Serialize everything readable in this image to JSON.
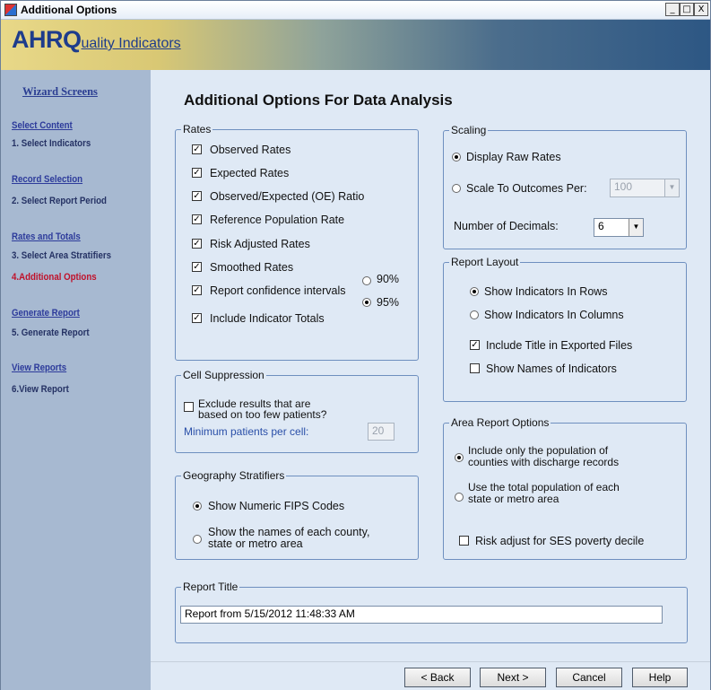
{
  "window": {
    "title": "Additional Options",
    "min": "_",
    "max": "□",
    "close": "X"
  },
  "banner": {
    "logo_big": "AHRQ",
    "logo_small": "uality Indicators"
  },
  "sidebar": {
    "heading": "Wizard Screens",
    "sections": [
      {
        "link": "Select Content",
        "step": "1. Select Indicators"
      },
      {
        "link": "Record Selection",
        "step": "2. Select Report Period"
      },
      {
        "link": "Rates and Totals",
        "step": "3. Select Area Stratifiers"
      },
      {
        "link": "",
        "step": "4.Additional Options"
      },
      {
        "link": "Generate Report",
        "step": "5. Generate Report"
      },
      {
        "link": "View Reports",
        "step": "6.View Report"
      }
    ]
  },
  "main": {
    "heading": "Additional Options For Data Analysis",
    "rates": {
      "legend": "Rates",
      "items": [
        {
          "label": "Observed Rates",
          "checked": true
        },
        {
          "label": "Expected Rates",
          "checked": true
        },
        {
          "label": "Observed/Expected (OE) Ratio",
          "checked": true
        },
        {
          "label": "Reference Population Rate",
          "checked": true
        },
        {
          "label": "Risk Adjusted Rates",
          "checked": true
        },
        {
          "label": "Smoothed Rates",
          "checked": true
        },
        {
          "label": "Report confidence intervals",
          "checked": true
        },
        {
          "label": "Include Indicator Totals",
          "checked": true
        }
      ],
      "ci_90": "90%",
      "ci_95": "95%",
      "ci_selected": "95%"
    },
    "scaling": {
      "legend": "Scaling",
      "display_raw": "Display Raw Rates",
      "scale_to": "Scale To Outcomes Per:",
      "scale_value": "100",
      "decimals_label": "Number of Decimals:",
      "decimals_value": "6",
      "selected": "Display Raw Rates"
    },
    "report_layout": {
      "legend": "Report Layout",
      "rows": "Show Indicators In Rows",
      "columns": "Show Indicators In Columns",
      "selected": "Show Indicators In Rows",
      "include_title": "Include Title in Exported Files",
      "include_title_checked": true,
      "show_names": "Show Names of Indicators",
      "show_names_checked": false
    },
    "cell_suppression": {
      "legend": "Cell Suppression",
      "exclude_line1": "Exclude results that are",
      "exclude_line2": "based on too few patients?",
      "exclude_checked": false,
      "min_label": "Minimum patients per cell:",
      "min_value": "20"
    },
    "geography": {
      "legend": "Geography Stratifiers",
      "fips": "Show Numeric FIPS Codes",
      "names_line1": "Show the names of each county,",
      "names_line2": "state or metro area",
      "selected": "Show Numeric FIPS Codes"
    },
    "area_report": {
      "legend": "Area Report Options",
      "opt1_line1": "Include only the population of",
      "opt1_line2": "counties with discharge records",
      "opt2_line1": "Use the total population of each",
      "opt2_line2": "state or metro area",
      "selected": "Include only the population of counties with discharge records",
      "ses": "Risk adjust for SES poverty decile",
      "ses_checked": false
    },
    "report_title": {
      "legend": "Report Title",
      "value": "Report from 5/15/2012 11:48:33 AM"
    }
  },
  "footer": {
    "back": "< Back",
    "next": "Next >",
    "cancel": "Cancel",
    "help": "Help"
  }
}
